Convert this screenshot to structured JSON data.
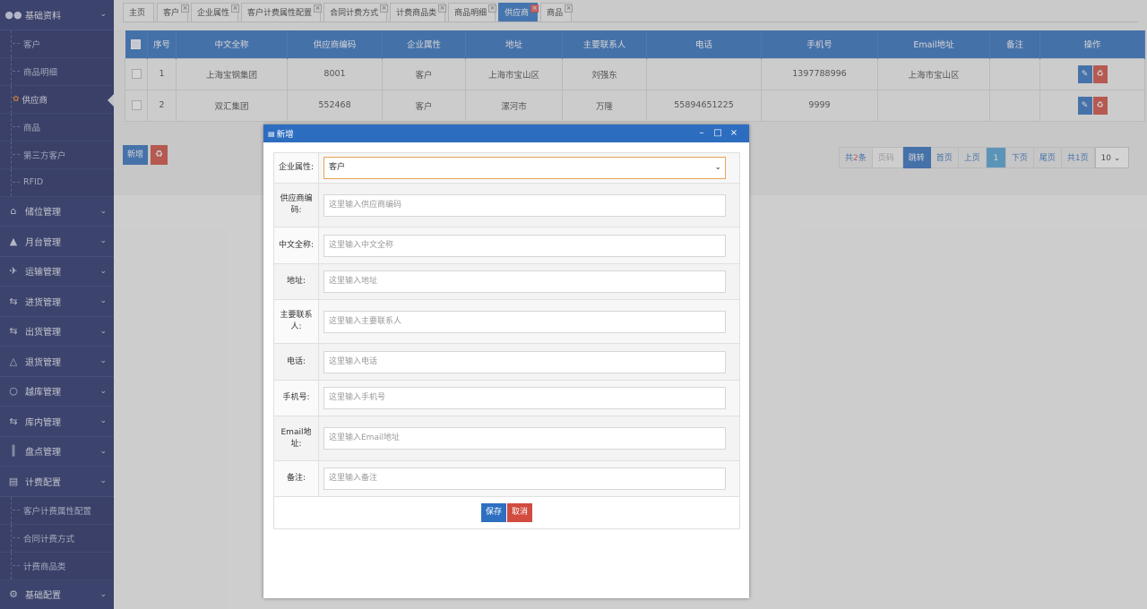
{
  "sidebar": {
    "groups": [
      {
        "label": "基础资料",
        "icon": "users-icon"
      },
      {
        "label": "储位管理",
        "icon": "home-icon"
      },
      {
        "label": "月台管理",
        "icon": "bell-icon"
      },
      {
        "label": "运输管理",
        "icon": "plane-icon"
      },
      {
        "label": "进货管理",
        "icon": "exchange-icon"
      },
      {
        "label": "出货管理",
        "icon": "exchange-icon"
      },
      {
        "label": "退货管理",
        "icon": "flask-icon"
      },
      {
        "label": "越库管理",
        "icon": "lightbulb-icon"
      },
      {
        "label": "库内管理",
        "icon": "exchange-icon"
      },
      {
        "label": "盘点管理",
        "icon": "barcode-icon"
      },
      {
        "label": "计费配置",
        "icon": "credit-card-icon"
      },
      {
        "label": "基础配置",
        "icon": "cogs-icon"
      }
    ],
    "base_items": [
      "客户",
      "商品明细",
      "供应商",
      "商品",
      "第三方客户",
      "RFID"
    ],
    "billing_items": [
      "客户计费属性配置",
      "合同计费方式",
      "计费商品类"
    ]
  },
  "tabs": [
    "主页",
    "客户",
    "企业属性",
    "客户计费属性配置",
    "合同计费方式",
    "计费商品类",
    "商品明细",
    "供应商",
    "商品"
  ],
  "grid": {
    "headers": [
      "序号",
      "中文全称",
      "供应商编码",
      "企业属性",
      "地址",
      "主要联系人",
      "电话",
      "手机号",
      "Email地址",
      "备注",
      "操作"
    ],
    "rows": [
      {
        "no": "1",
        "name": "上海宝钢集团",
        "code": "8001",
        "attr": "客户",
        "address": "上海市宝山区",
        "contact": "刘强东",
        "phone": "",
        "mobile": "1397788996",
        "email": "上海市宝山区",
        "remark": ""
      },
      {
        "no": "2",
        "name": "双汇集团",
        "code": "552468",
        "attr": "客户",
        "address": "漯河市",
        "contact": "万隆",
        "phone": "55894651225",
        "mobile": "9999",
        "email": "",
        "remark": ""
      }
    ]
  },
  "toolbar": {
    "add_label": "新增"
  },
  "pager": {
    "total_prefix": "共",
    "total_count": "2",
    "total_suffix": "条",
    "page_placeholder": "页码",
    "jump": "跳转",
    "first": "首页",
    "prev": "上页",
    "current": "1",
    "next": "下页",
    "last": "尾页",
    "pages": "共1页",
    "page_size": "10"
  },
  "modal": {
    "title": "新增",
    "fields": [
      {
        "label": "企业属性:",
        "value": "客户",
        "type": "select"
      },
      {
        "label": "供应商编码:",
        "placeholder": "这里输入供应商编码"
      },
      {
        "label": "中文全称:",
        "placeholder": "这里输入中文全称"
      },
      {
        "label": "地址:",
        "placeholder": "这里输入地址"
      },
      {
        "label": "主要联系人:",
        "placeholder": "这里输入主要联系人"
      },
      {
        "label": "电话:",
        "placeholder": "这里输入电话"
      },
      {
        "label": "手机号:",
        "placeholder": "这里输入手机号"
      },
      {
        "label": "Email地址:",
        "placeholder": "这里输入Email地址"
      },
      {
        "label": "备注:",
        "placeholder": "这里输入备注"
      }
    ],
    "save": "保存",
    "cancel": "取消"
  },
  "colors": {
    "sidebar": "#1f2a67",
    "primary": "#2d6dc0",
    "danger": "#d14b3f"
  }
}
